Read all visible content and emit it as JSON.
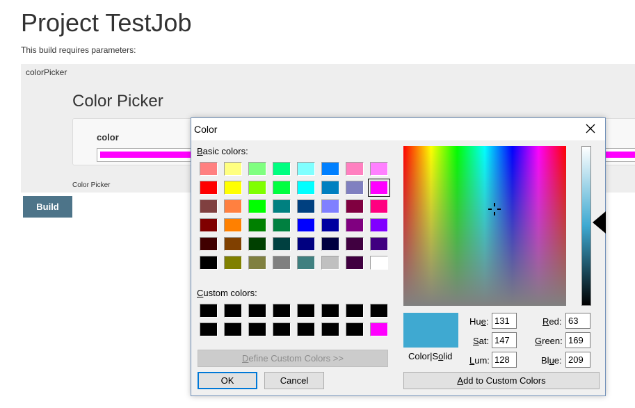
{
  "page": {
    "title": "Project TestJob",
    "subtitle": "This build requires parameters:",
    "param_name": "colorPicker",
    "color_picker_heading": "Color Picker",
    "field_label": "color",
    "field_value_color": "#ff00ff",
    "field_description": "Color Picker",
    "build_button": "Build"
  },
  "dialog": {
    "title": "Color",
    "basic_colors_label": {
      "accel": "B",
      "rest": "asic colors:"
    },
    "custom_colors_label": {
      "accel": "C",
      "rest": "ustom colors:"
    },
    "basic_colors": [
      [
        "#ff8080",
        "#ffff80",
        "#80ff80",
        "#00ff80",
        "#80ffff",
        "#0080ff",
        "#ff80c0",
        "#ff80ff"
      ],
      [
        "#ff0000",
        "#ffff00",
        "#80ff00",
        "#00ff40",
        "#00ffff",
        "#0080c0",
        "#8080c0",
        "#ff00ff"
      ],
      [
        "#804040",
        "#ff8040",
        "#00ff00",
        "#008080",
        "#004080",
        "#8080ff",
        "#800040",
        "#ff0080"
      ],
      [
        "#800000",
        "#ff8000",
        "#008000",
        "#008040",
        "#0000ff",
        "#0000a0",
        "#800080",
        "#8000ff"
      ],
      [
        "#400000",
        "#804000",
        "#004000",
        "#004040",
        "#000080",
        "#000040",
        "#400040",
        "#400080"
      ],
      [
        "#000000",
        "#808000",
        "#808040",
        "#808080",
        "#408080",
        "#c0c0c0",
        "#400040",
        "#ffffff"
      ]
    ],
    "selected_basic": [
      1,
      7
    ],
    "custom_colors": [
      [
        "#000000",
        "#000000",
        "#000000",
        "#000000",
        "#000000",
        "#000000",
        "#000000",
        "#000000"
      ],
      [
        "#000000",
        "#000000",
        "#000000",
        "#000000",
        "#000000",
        "#000000",
        "#000000",
        "#ff00ff"
      ]
    ],
    "define_custom_button": {
      "accel": "D",
      "rest": "efine Custom Colors >>"
    },
    "ok_button": "OK",
    "cancel_button": "Cancel",
    "preview_color": "#3fa9d1",
    "color_solid_label": {
      "pre": "Color|S",
      "accel": "o",
      "post": "lid"
    },
    "hue": {
      "pre": "Hu",
      "accel": "e",
      "post": ":",
      "value": "131"
    },
    "sat": {
      "pre": "",
      "accel": "S",
      "post": "at:",
      "value": "147"
    },
    "lum": {
      "pre": "",
      "accel": "L",
      "post": "um:",
      "value": "128"
    },
    "red": {
      "pre": "",
      "accel": "R",
      "post": "ed:",
      "value": "63"
    },
    "green": {
      "pre": "",
      "accel": "G",
      "post": "reen:",
      "value": "169"
    },
    "blue": {
      "pre": "Bl",
      "accel": "u",
      "post": "e:",
      "value": "209"
    },
    "add_custom_button": {
      "accel": "A",
      "rest": "dd to Custom Colors"
    }
  }
}
